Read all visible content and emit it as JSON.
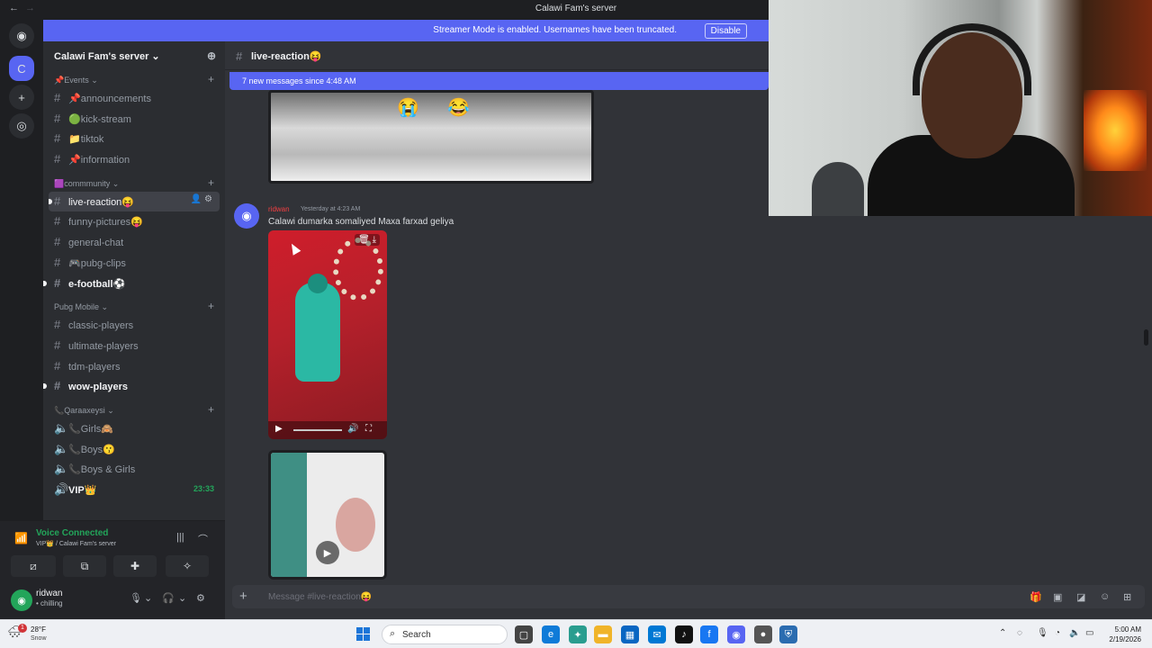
{
  "titlebar": {
    "title": "Calawi Fam's server",
    "back": "←",
    "forward": "→"
  },
  "banner": {
    "text": "Streamer Mode is enabled. Usernames have been truncated.",
    "button": "Disable"
  },
  "servers": [
    {
      "name": "discord-home-icon",
      "glyph": "◉"
    },
    {
      "name": "server-calawi-icon",
      "glyph": "C"
    },
    {
      "name": "add-server-icon",
      "glyph": "+"
    },
    {
      "name": "discover-icon",
      "glyph": "◎"
    }
  ],
  "sidebar": {
    "server_name": "Calawi Fam's server ⌄",
    "categories": [
      {
        "label": "📌Events ⌄",
        "channels": [
          {
            "label": "📌announcements"
          },
          {
            "label": "🟢kick-stream"
          },
          {
            "label": "📁tiktok"
          },
          {
            "label": "📌information"
          }
        ]
      },
      {
        "label": "🟪commmunity ⌄",
        "channels": [
          {
            "label": "live-reaction😝"
          },
          {
            "label": "funny-pictures😝"
          },
          {
            "label": "general-chat"
          },
          {
            "label": "🎮pubg-clips"
          },
          {
            "label": "e-football⚽"
          }
        ]
      },
      {
        "label": "Pubg Mobile ⌄",
        "channels": [
          {
            "label": "classic-players"
          },
          {
            "label": "ultimate-players"
          },
          {
            "label": "tdm-players"
          },
          {
            "label": "wow-players"
          }
        ]
      },
      {
        "label": "📞Qaraaxeysi ⌄",
        "channels": [
          {
            "label": "📞Girls🙈"
          },
          {
            "label": "📞Boys😗"
          },
          {
            "label": "📞Boys & Girls"
          },
          {
            "label": "VIP👑",
            "time": "23:33"
          }
        ]
      }
    ]
  },
  "voice": {
    "status": "Voice Connected",
    "sub": "VIP👑 / Calawi Fam's server"
  },
  "user": {
    "name": "ridwan",
    "status": "• chilling"
  },
  "channel": {
    "name": "live-reaction😝"
  },
  "main": {
    "new_messages": "7 new messages since 4:48 AM",
    "message": {
      "author": "ridwan",
      "time": "Yesterday at 4:23 AM",
      "text": "Calawi dumarka somaliyed Maxa farxad geliya"
    }
  },
  "composer": {
    "placeholder": "Message #live-reaction😝"
  },
  "taskbar": {
    "temp": "28°F",
    "cond": "Snow",
    "search": "Search",
    "time": "5:00 AM",
    "date": "2/19/2026",
    "badge": "1"
  },
  "colors": {
    "accent": "#5865f2",
    "online": "#23a55a",
    "author": "#f23f42"
  }
}
